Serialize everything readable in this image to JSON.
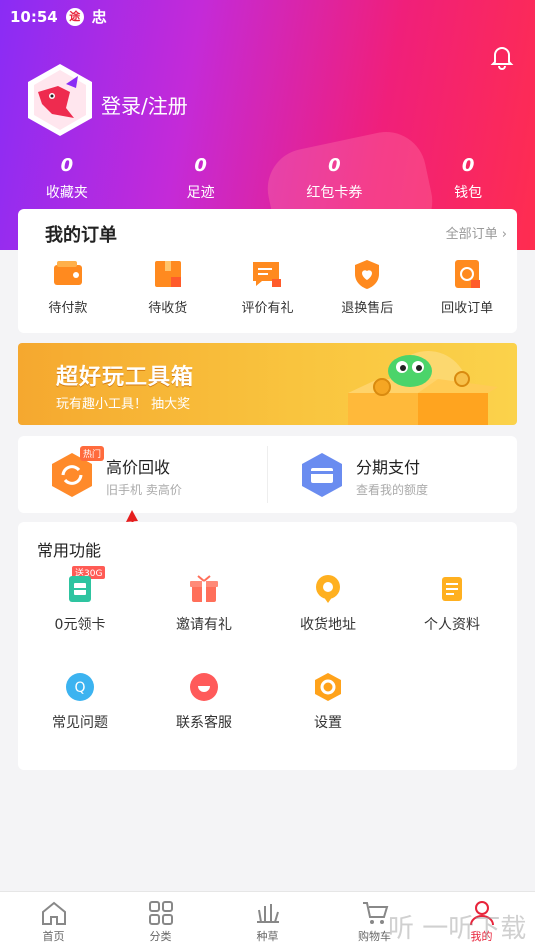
{
  "status_bar": {
    "time": "10:54",
    "badge": "途",
    "extra": "忠"
  },
  "header": {
    "login_label": "登录/注册"
  },
  "stats": [
    {
      "value": "0",
      "label": "收藏夹"
    },
    {
      "value": "0",
      "label": "足迹"
    },
    {
      "value": "0",
      "label": "红包卡券"
    },
    {
      "value": "0",
      "label": "钱包"
    }
  ],
  "orders": {
    "title": "我的订单",
    "all_label": "全部订单 ›",
    "items": [
      {
        "label": "待付款",
        "icon": "wallet-icon"
      },
      {
        "label": "待收货",
        "icon": "package-icon"
      },
      {
        "label": "评价有礼",
        "icon": "comment-icon"
      },
      {
        "label": "退换售后",
        "icon": "shield-icon"
      },
      {
        "label": "回收订单",
        "icon": "recycle-icon"
      }
    ]
  },
  "banner": {
    "headline": "超好玩工具箱",
    "sub": "玩有趣小工具！ 抽大奖"
  },
  "services": {
    "recycle": {
      "title": "高价回收",
      "sub": "旧手机 卖高价",
      "hot": "热门"
    },
    "installment": {
      "title": "分期支付",
      "sub": "查看我的额度"
    }
  },
  "common": {
    "title": "常用功能",
    "tag": "送30G",
    "items": [
      {
        "label": "0元领卡",
        "icon": "sim-card-icon"
      },
      {
        "label": "邀请有礼",
        "icon": "gift-icon"
      },
      {
        "label": "收货地址",
        "icon": "location-icon"
      },
      {
        "label": "个人资料",
        "icon": "profile-icon"
      },
      {
        "label": "常见问题",
        "icon": "faq-icon"
      },
      {
        "label": "联系客服",
        "icon": "service-icon"
      },
      {
        "label": "设置",
        "icon": "settings-icon"
      }
    ]
  },
  "tabbar": [
    {
      "label": "首页",
      "icon": "home-icon"
    },
    {
      "label": "分类",
      "icon": "category-icon"
    },
    {
      "label": "种草",
      "icon": "grass-icon"
    },
    {
      "label": "购物车",
      "icon": "cart-icon"
    },
    {
      "label": "我的",
      "icon": "user-icon",
      "active": true
    }
  ],
  "watermark": "听 一听下载",
  "colors": {
    "accent": "#e8243b",
    "gradient_start": "#8a2cf5",
    "gradient_end": "#ff2d4f"
  }
}
